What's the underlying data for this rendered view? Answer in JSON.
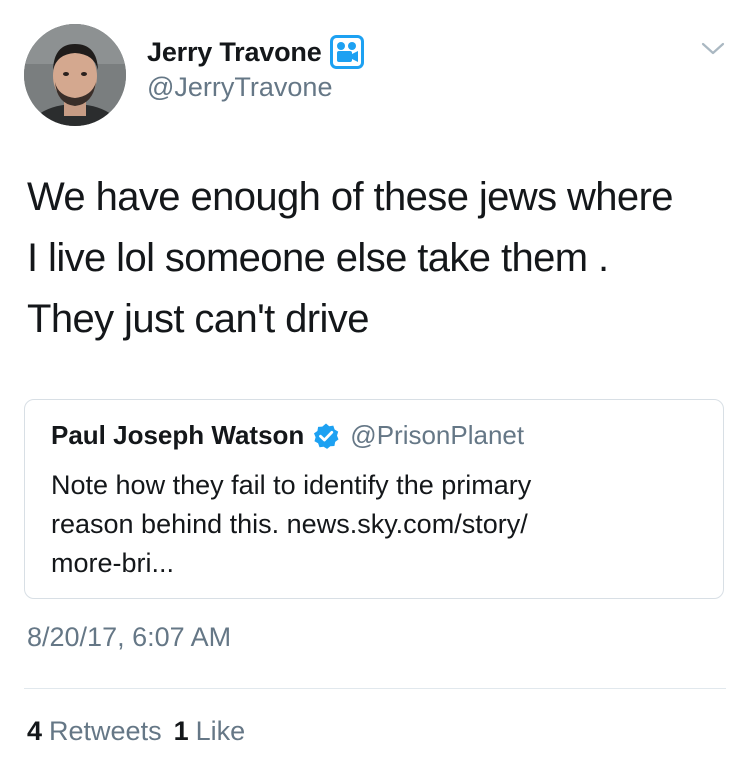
{
  "author": {
    "name": "Jerry Travone",
    "handle": "@JerryTravone",
    "badge_icon": "translator-badge-icon"
  },
  "tweet": {
    "text_lines": [
      "We have enough of these jews where",
      "I live lol someone else take them .",
      "They just can't drive"
    ],
    "timestamp": "8/20/17, 6:07 AM"
  },
  "quoted_tweet": {
    "name": "Paul Joseph Watson",
    "verified": true,
    "handle": "@PrisonPlanet",
    "text_lines": [
      "Note how they fail to identify the primary",
      "reason behind this. news.sky.com/story/",
      "more-bri..."
    ]
  },
  "stats": {
    "retweets_count": "4",
    "retweets_label": "Retweets",
    "likes_count": "1",
    "likes_label": "Like"
  },
  "colors": {
    "primary_text": "#14171a",
    "secondary_text": "#657786",
    "verified_blue": "#1da1f2",
    "border": "#d8dfe5"
  }
}
